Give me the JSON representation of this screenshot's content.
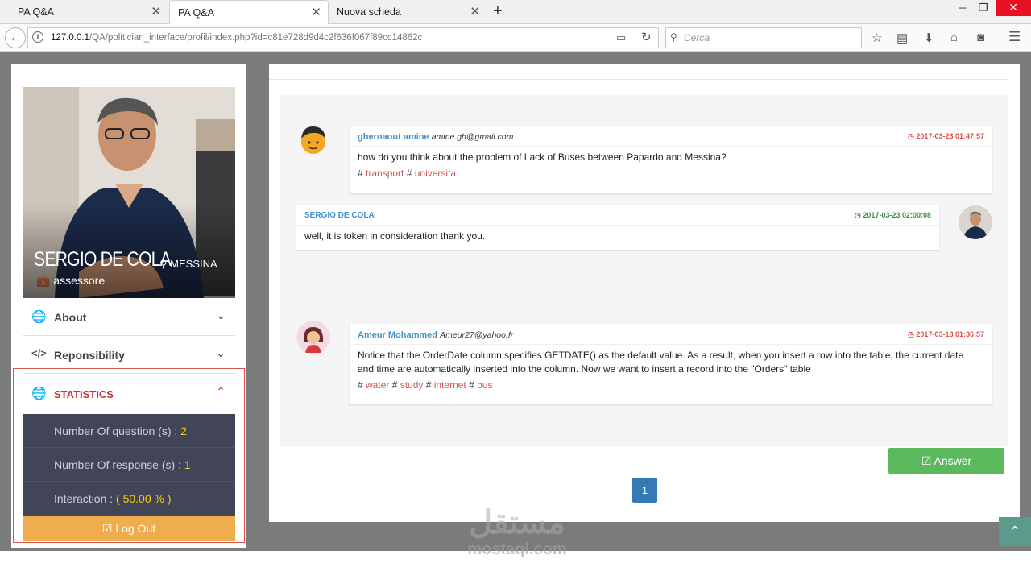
{
  "browser": {
    "tabs": [
      {
        "label": "PA Q&A",
        "active": false
      },
      {
        "label": "PA Q&A",
        "active": true
      },
      {
        "label": "Nuova scheda",
        "active": false
      }
    ],
    "url_host": "127.0.0.1",
    "url_path": "/QA/politician_interface/profil/index.php?id=c81e728d9d4c2f636f067f89cc14862c",
    "search_placeholder": "Cerca"
  },
  "profile": {
    "name": "SERGIO DE COLA",
    "city": "MESSINA",
    "role": "assessore"
  },
  "menu": {
    "about": "About",
    "responsibility": "Reponsibility",
    "statistics": "STATISTICS"
  },
  "statistics": {
    "questions_label": "Number Of question (s) : ",
    "questions_value": "2",
    "responses_label": "Number Of response (s) : ",
    "responses_value": "1",
    "interaction_label": "Interaction : ",
    "interaction_value": "( 50.00 % )",
    "logout_label": "Log Out"
  },
  "messages": [
    {
      "author": "ghernaout amine",
      "email": "amine.gh@gmail.com",
      "timestamp": "2017-03-23 01:47:57",
      "text": "how do you think about the problem of Lack of Buses between Papardo and Messina?",
      "tags": [
        "transport",
        "universita"
      ]
    },
    {
      "author": "SERGIO DE COLA",
      "timestamp": "2017-03-23 02:00:08",
      "text": "well, it is token in consideration thank you."
    },
    {
      "author": "Ameur Mohammed",
      "email": "Ameur27@yahoo.fr",
      "timestamp": "2017-03-18 01:36:57",
      "text": "Notice that the OrderDate column specifies GETDATE() as the default value. As a result, when you insert a row into the table, the current date and time are automatically inserted into the column. Now we want to insert a record into the \"Orders\" table",
      "tags": [
        "water",
        "study",
        "internet",
        "bus"
      ]
    }
  ],
  "answer_label": "Answer",
  "pagination": {
    "current": "1"
  },
  "watermark": {
    "arabic": "مستقل",
    "latin": "mostaql.com"
  },
  "colors": {
    "accent_blue": "#4193c8",
    "timestamp_red": "#d9534f",
    "timestamp_green": "#3c8c3c",
    "answer_green": "#5cb85c",
    "logout_orange": "#f0ad4e",
    "stats_bg": "#424457",
    "stat_value_yellow": "#f5d00c"
  }
}
